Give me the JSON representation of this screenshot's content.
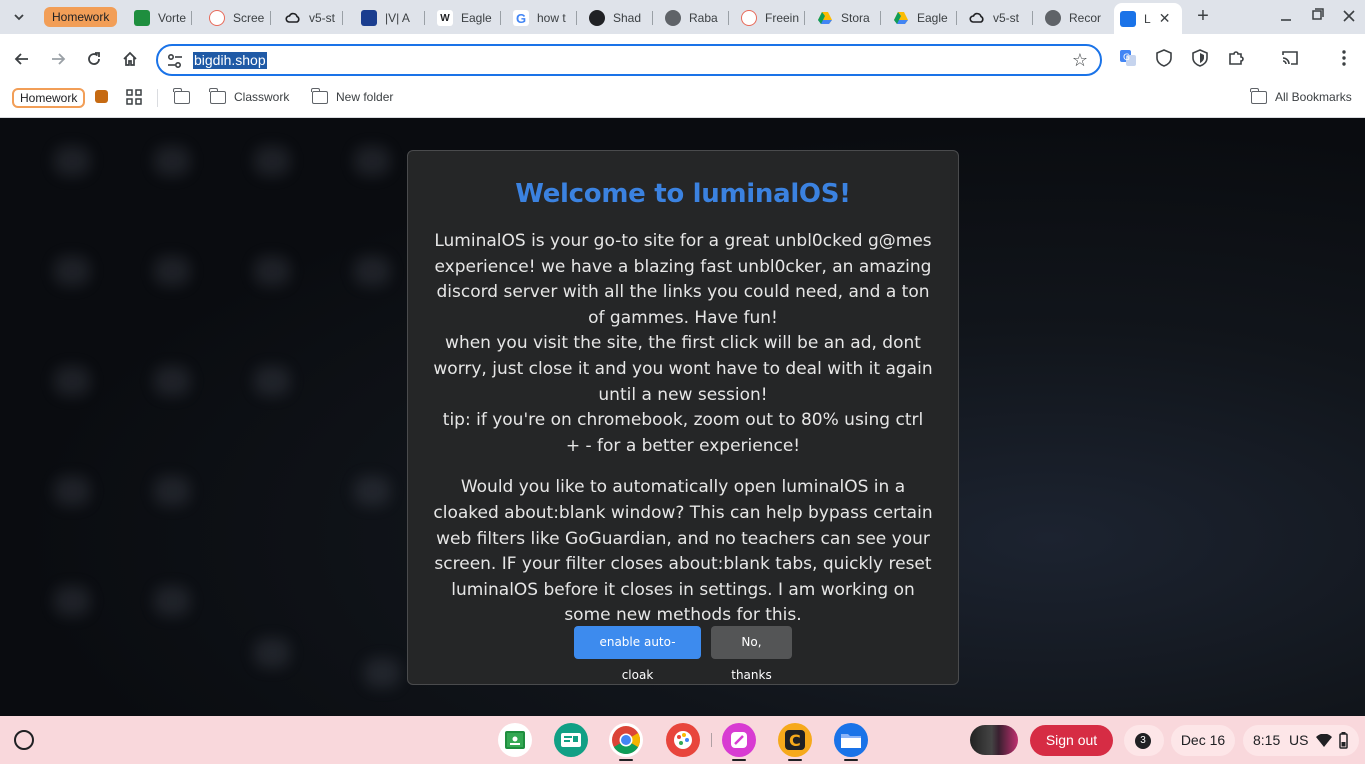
{
  "tabstrip": {
    "group_label": "Homework",
    "tabs": [
      {
        "title": "Vorte",
        "icon": "classroom-icon",
        "color": "#1e8e3e"
      },
      {
        "title": "Scree",
        "icon": "screencastify-icon",
        "color": "#e86a5a"
      },
      {
        "title": "v5-st",
        "icon": "cloud-icon",
        "color": "#202124"
      },
      {
        "title": "|V| A",
        "icon": "vortex-icon",
        "color": "#1a3d8f"
      },
      {
        "title": "Eagle",
        "icon": "eagle-icon",
        "color": "#202124"
      },
      {
        "title": "how t",
        "icon": "google-icon",
        "color": "#4285f4"
      },
      {
        "title": "Shad",
        "icon": "shadow-icon",
        "color": "#202124"
      },
      {
        "title": "Raba",
        "icon": "globe-icon",
        "color": "#5f6368"
      },
      {
        "title": "Freein",
        "icon": "screencastify-icon",
        "color": "#e86a5a"
      },
      {
        "title": "Stora",
        "icon": "drive-icon",
        "color": "#fbbc04"
      },
      {
        "title": "Eagle",
        "icon": "drive-icon",
        "color": "#fbbc04"
      },
      {
        "title": "v5-st",
        "icon": "cloud-icon",
        "color": "#202124"
      },
      {
        "title": "Recor",
        "icon": "globe-icon",
        "color": "#5f6368"
      }
    ],
    "active_tab": {
      "title": "L",
      "icon": "luminal-icon",
      "color": "#1a73e8"
    }
  },
  "toolbar": {
    "url": "bigdih.shop"
  },
  "bookmarks": {
    "group_label": "Homework",
    "items": [
      {
        "label": ""
      },
      {
        "label": "Classwork"
      },
      {
        "label": "New folder"
      }
    ],
    "all_label": "All Bookmarks"
  },
  "modal": {
    "title": "Welcome to luminalOS!",
    "intro_1": "LuminalOS is your go-to site for a great unbl0cked g@mes experience! we have a blazing fast unbl0cker, an amazing discord server with all the links you could need, and a ton of gammes. Have fun!",
    "intro_2": "when you visit the site, the first click will be an ad, dont worry, just close it and you wont have to deal with it again until a new session!",
    "intro_3": "tip: if you're on chromebook, zoom out to 80% using ctrl + - for a better experience!",
    "question": "Would you like to automatically open luminalOS in a cloaked about:blank window? This can help bypass certain web filters like GoGuardian, and no teachers can see your screen. IF your filter closes about:blank tabs, quickly reset luminalOS before it closes in settings. I am working on some new methods for this.",
    "accept_label": "enable auto-cloak",
    "decline_label": "No, thanks"
  },
  "shelf": {
    "apps": [
      {
        "name": "classroom-icon",
        "color": "#1e8e3e"
      },
      {
        "name": "screencast-icon",
        "color": "#12a085"
      },
      {
        "name": "chrome-icon",
        "color": "#4285f4"
      },
      {
        "name": "paint-icon",
        "color": "#e8453c"
      },
      {
        "name": "canvas-icon",
        "color": "#d83bd2"
      },
      {
        "name": "c-app-icon",
        "color": "#f6a91b"
      },
      {
        "name": "files-icon",
        "color": "#1a73e8"
      }
    ],
    "signout_label": "Sign out",
    "notification_count": "3",
    "date": "Dec 16",
    "time": "8:15",
    "locale": "US"
  }
}
